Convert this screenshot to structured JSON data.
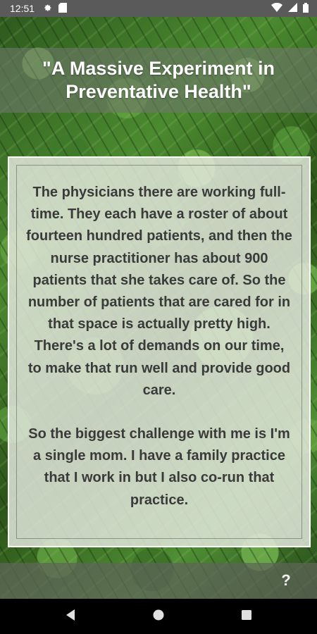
{
  "status_bar": {
    "time": "12:51",
    "left_icons": [
      "gear-icon",
      "sd-card-icon"
    ],
    "right_icons": [
      "wifi-icon",
      "cell-signal-icon",
      "battery-icon"
    ]
  },
  "header": {
    "title": "\"A Massive Experiment in Preventative Health\""
  },
  "content": {
    "paragraphs": [
      "The physicians there are working full-time. They each have a roster of about fourteen hundred patients, and then the nurse practitioner has about 900 patients that she takes care of. So the number of patients that are cared for in that space is actually pretty high. There's a lot of demands on our time, to make that run well and provide good care.",
      "So the biggest challenge with me is I'm a single mom. I have a family practice that I work in but I also co-run that practice."
    ]
  },
  "bottom_bar": {
    "help_label": "?"
  },
  "nav_bar": {
    "icons": [
      "back-icon",
      "home-icon",
      "recents-icon"
    ]
  },
  "colors": {
    "status_bar_bg": "#5a5a5a",
    "card_bg": "#e4e8de",
    "card_text": "#3a3a3a",
    "title_text": "#ffffff",
    "nav_bar_bg": "#000000"
  }
}
